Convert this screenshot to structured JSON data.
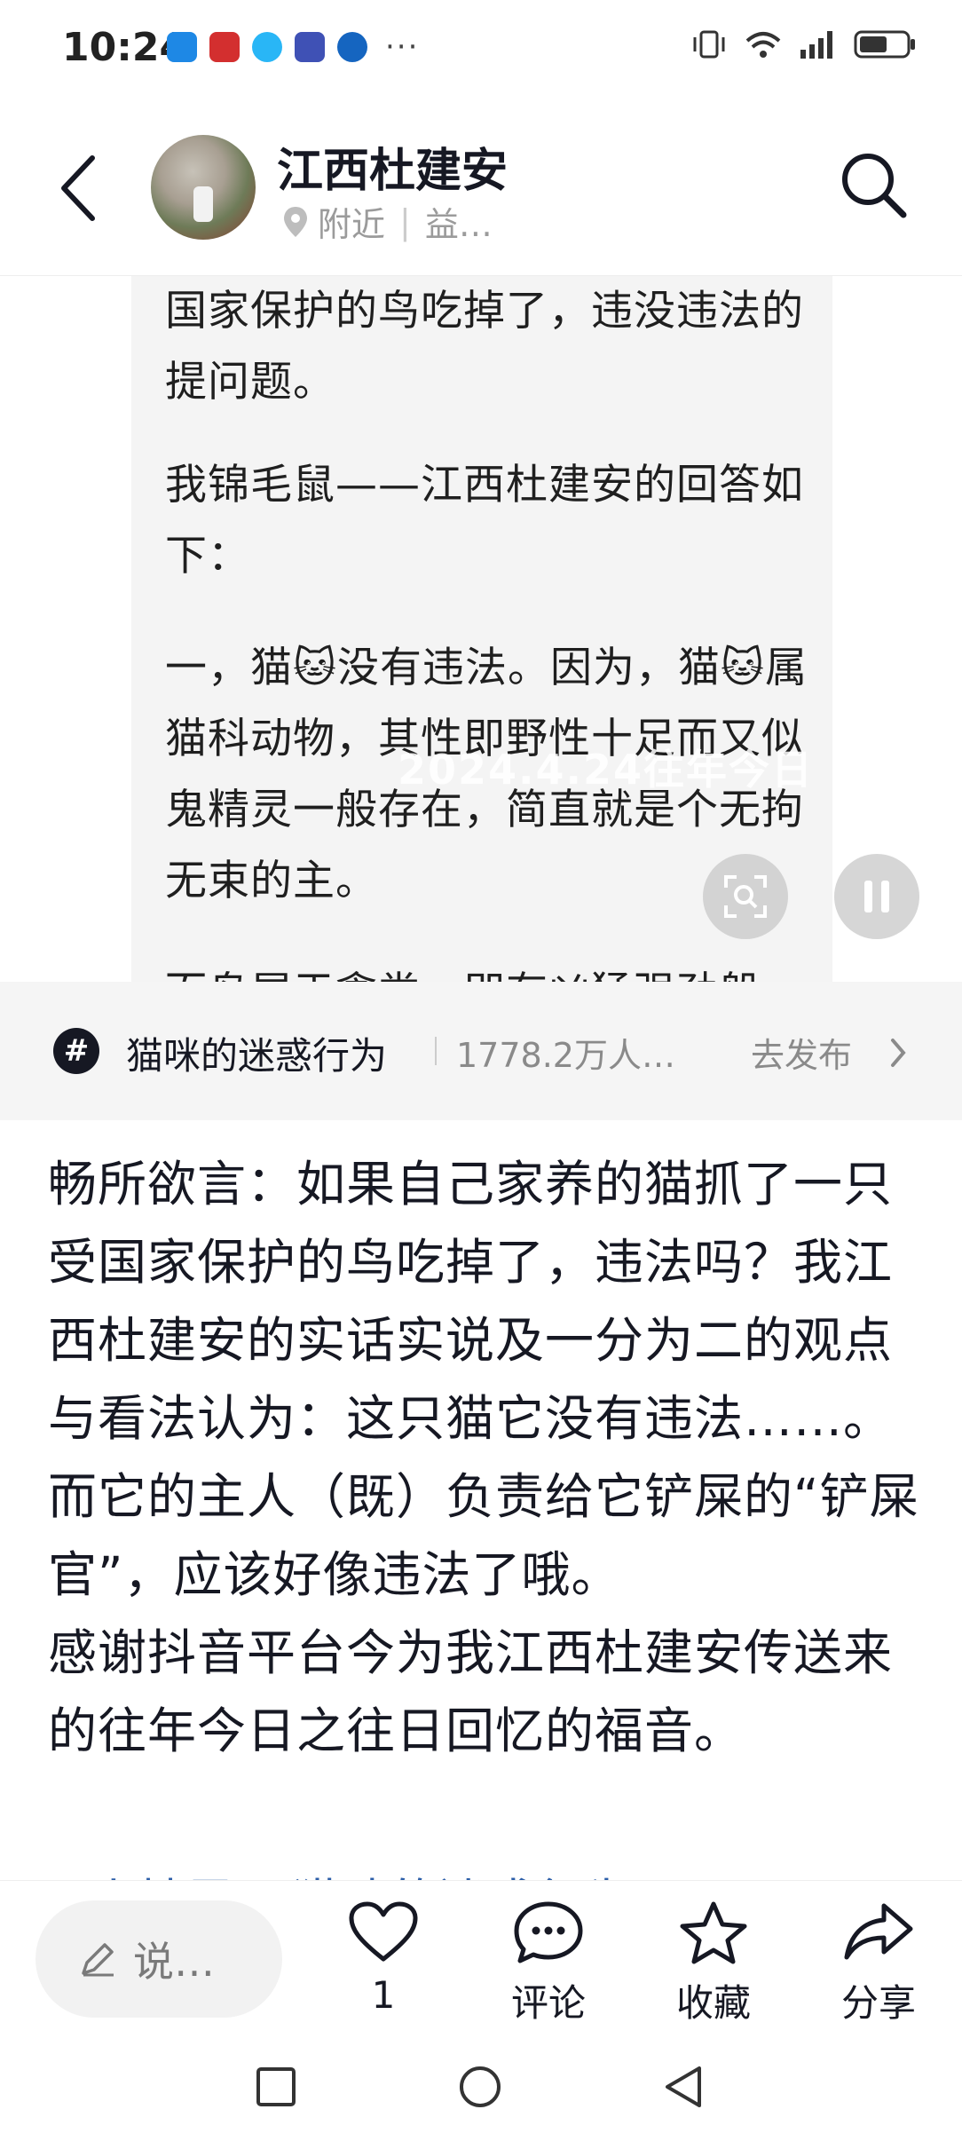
{
  "status_bar": {
    "time": "10:24",
    "more": "···",
    "battery_level": 0.6
  },
  "header": {
    "author": "江西杜建安",
    "location_label": "附近",
    "location_extra": "益…"
  },
  "image_card": {
    "paragraphs": [
      "国家保护的鸟吃掉了，违没违法的提问题。",
      "我锦毛鼠——江西杜建安的回答如下：",
      "一，猫🐱没有违法。因为，猫🐱属猫科动物，其性即野性十足而又似鬼精灵一般存在，简直就是个无拘无束的主。",
      "而鸟属于禽类，即有凶猛强劲般"
    ],
    "watermark": "2024.4.24往年今日"
  },
  "topic": {
    "name": "猫咪的迷惑行为",
    "count": "1778.2万人…",
    "action": "去发布"
  },
  "post": {
    "lines": [
      "畅所欲言：如果自己家养的猫抓了一只受国家保护的鸟吃掉了，违法吗？我江西杜建安的实话实说及一分为二的观点与看法认为：这只猫它没有违法……。而它的主人（既）负责给它铲屎的“铲屎官”，应该好像违法了哦。",
      "感谢抖音平台今为我江西杜建安传送来的往年今日之往日回忆的福音。"
    ],
    "tags": "#小精灵 #猫咪的迷惑行为"
  },
  "action_bar": {
    "comment_placeholder": "说…",
    "like_count": "1",
    "comment_label": "评论",
    "favorite_label": "收藏",
    "share_label": "分享"
  }
}
